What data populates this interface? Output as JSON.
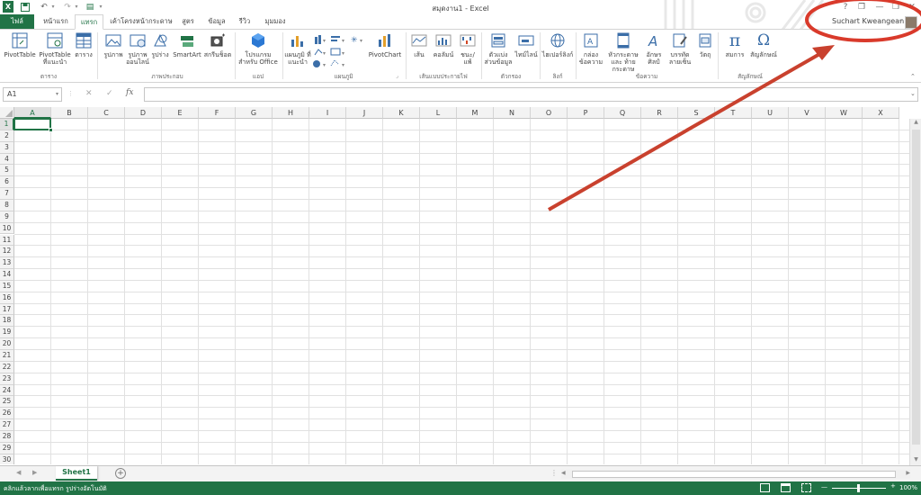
{
  "window": {
    "title": "สมุดงาน1 - Excel",
    "user_name": "Suchart Kweangean",
    "controls": [
      "?",
      "❐",
      "—",
      "❐",
      "✕"
    ]
  },
  "tabs": [
    {
      "label": "ไฟล์"
    },
    {
      "label": "หน้าแรก"
    },
    {
      "label": "แทรก"
    },
    {
      "label": "เค้าโครงหน้ากระดาษ"
    },
    {
      "label": "สูตร"
    },
    {
      "label": "ข้อมูล"
    },
    {
      "label": "รีวิว"
    },
    {
      "label": "มุมมอง"
    }
  ],
  "ribbon": {
    "buttons": [
      {
        "label": "PivotTable"
      },
      {
        "label": "PivotTable ที่แนะนำ"
      },
      {
        "label": "ตาราง"
      },
      {
        "label": "รูปภาพ"
      },
      {
        "label": "รูปภาพ ออนไลน์"
      },
      {
        "label": "รูปร่าง"
      },
      {
        "label": "SmartArt"
      },
      {
        "label": "สกรีนช็อต"
      },
      {
        "label": "โปรแกรมสำหรับ Office"
      },
      {
        "label": "แผนภูมิ ที่แนะนำ"
      },
      {
        "label": "PivotChart"
      },
      {
        "label": "เส้น"
      },
      {
        "label": "คอลัมน์"
      },
      {
        "label": "ชนะ/ แพ้"
      },
      {
        "label": "ตัวแบ่ง ส่วนข้อมูล"
      },
      {
        "label": "ไทม์ไลน์"
      },
      {
        "label": "ไฮเปอร์ลิงก์"
      },
      {
        "label": "กล่อง ข้อความ"
      },
      {
        "label": "หัวกระดาษและ ท้ายกระดาษ"
      },
      {
        "label": "อักษร ศิลป์"
      },
      {
        "label": "บรรทัด ลายเซ็น"
      },
      {
        "label": "วัตถุ"
      },
      {
        "label": "สมการ"
      },
      {
        "label": "สัญลักษณ์"
      }
    ],
    "groups": [
      {
        "label": "ตาราง"
      },
      {
        "label": "ภาพประกอบ"
      },
      {
        "label": "แอป"
      },
      {
        "label": "แผนภูมิ"
      },
      {
        "label": "เส้นแบบประกายไฟ"
      },
      {
        "label": "ตัวกรอง"
      },
      {
        "label": "ลิงก์"
      },
      {
        "label": "ข้อความ"
      },
      {
        "label": "สัญลักษณ์"
      }
    ]
  },
  "formula_bar": {
    "name_box": "A1",
    "fx": "fx",
    "cancel": "✕",
    "enter": "✓",
    "value": ""
  },
  "grid": {
    "columns": [
      "A",
      "B",
      "C",
      "D",
      "E",
      "F",
      "G",
      "H",
      "I",
      "J",
      "K",
      "L",
      "M",
      "N",
      "O",
      "P",
      "Q",
      "R",
      "S",
      "T",
      "U",
      "V",
      "W",
      "X"
    ],
    "rows": [
      "1",
      "2",
      "3",
      "4",
      "5",
      "6",
      "7",
      "8",
      "9",
      "10",
      "11",
      "12",
      "13",
      "14",
      "15",
      "16",
      "17",
      "18",
      "19",
      "20",
      "21",
      "22",
      "23",
      "24",
      "25",
      "26",
      "27",
      "28",
      "29",
      "30"
    ],
    "selected_cell": "A1"
  },
  "sheets": [
    {
      "name": "Sheet1",
      "active": true
    }
  ],
  "status": {
    "text": "คลิกแล้วลากเพื่อแทรก รูปร่างอัตโนมัติ",
    "zoom": "100%",
    "zoom_minus": "—",
    "zoom_plus": "+"
  },
  "colors": {
    "accent": "#217346",
    "annotation": "#d93a2b"
  }
}
